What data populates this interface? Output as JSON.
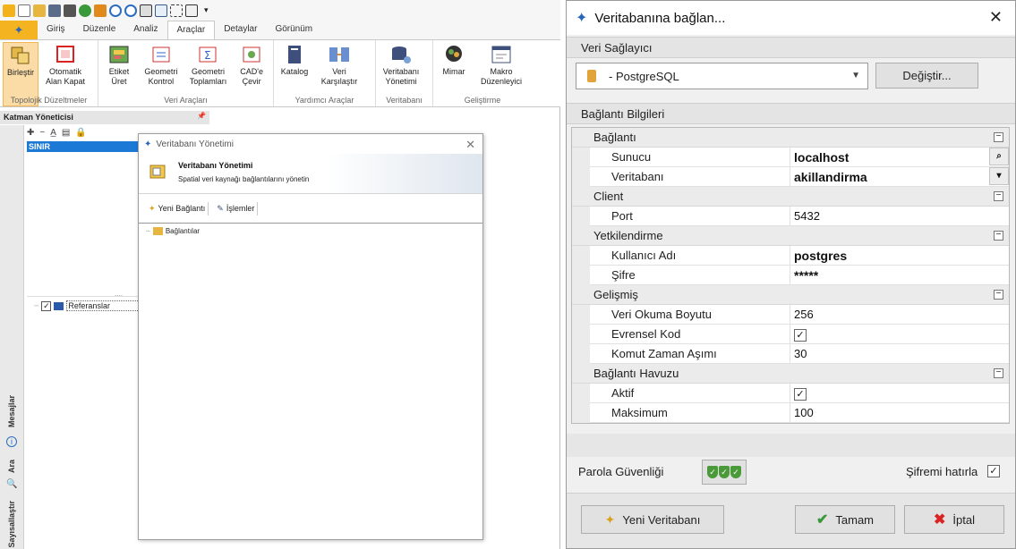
{
  "app": {
    "tabs": [
      "Giriş",
      "Düzenle",
      "Analiz",
      "Araçlar",
      "Detaylar",
      "Görünüm"
    ],
    "ribbon_groups": [
      {
        "caption": "Topolojik Düzeltmeler",
        "buttons": [
          "Birleştir",
          "Otomatik Alan Kapat"
        ]
      },
      {
        "caption": "Veri Araçları",
        "buttons": [
          "Etiket Üret",
          "Geometri Kontrol",
          "Geometri Toplamları",
          "CAD'e Çevir"
        ]
      },
      {
        "caption": "Yardımcı Araçlar",
        "buttons": [
          "Katalog",
          "Veri Karşılaştır"
        ]
      },
      {
        "caption": "Veritabanı",
        "buttons": [
          "Veritabanı Yönetimi"
        ]
      },
      {
        "caption": "Geliştirme",
        "buttons": [
          "Mimar",
          "Makro Düzenleyici"
        ]
      }
    ],
    "layer_manager": {
      "title": "Katman Yöneticisi",
      "selected_layer": "SINIR",
      "reference_item": "Referanslar",
      "side_tabs": [
        "Mesajlar",
        "Ara",
        "Sayısallaştır"
      ]
    }
  },
  "inner_dialog": {
    "title": "Veritabanı Yönetimi",
    "header_title": "Veritabanı Yönetimi",
    "header_desc": "Spatial veri kaynağı bağlantılarını yönetin",
    "toolbar": {
      "new_connection": "Yeni Bağlantı",
      "operations": "İşlemler"
    },
    "tree_root": "Bağlantılar"
  },
  "dialog": {
    "title": "Veritabanına bağlan...",
    "provider_section": "Veri Sağlayıcı",
    "provider_value": "- PostgreSQL",
    "change_button": "Değiştir...",
    "info_section": "Bağlantı Bilgileri",
    "categories": {
      "connection": "Bağlantı",
      "client": "Client",
      "auth": "Yetkilendirme",
      "advanced": "Gelişmiş",
      "pool": "Bağlantı Havuzu"
    },
    "fields": {
      "server_label": "Sunucu",
      "server_value": "localhost",
      "database_label": "Veritabanı",
      "database_value": "akillandirma",
      "port_label": "Port",
      "port_value": "5432",
      "username_label": "Kullanıcı Adı",
      "username_value": "postgres",
      "password_label": "Şifre",
      "password_value": "*****",
      "read_size_label": "Veri Okuma Boyutu",
      "read_size_value": "256",
      "universal_code_label": "Evrensel Kod",
      "universal_code_checked": true,
      "timeout_label": "Komut Zaman Aşımı",
      "timeout_value": "30",
      "active_label": "Aktif",
      "active_checked": true,
      "max_label": "Maksimum",
      "max_value": "100"
    },
    "password_strength_label": "Parola Güvenliği",
    "remember_password_label": "Şifremi hatırla",
    "remember_password_checked": true,
    "buttons": {
      "new_db": "Yeni Veritabanı",
      "ok": "Tamam",
      "cancel": "İptal"
    }
  }
}
